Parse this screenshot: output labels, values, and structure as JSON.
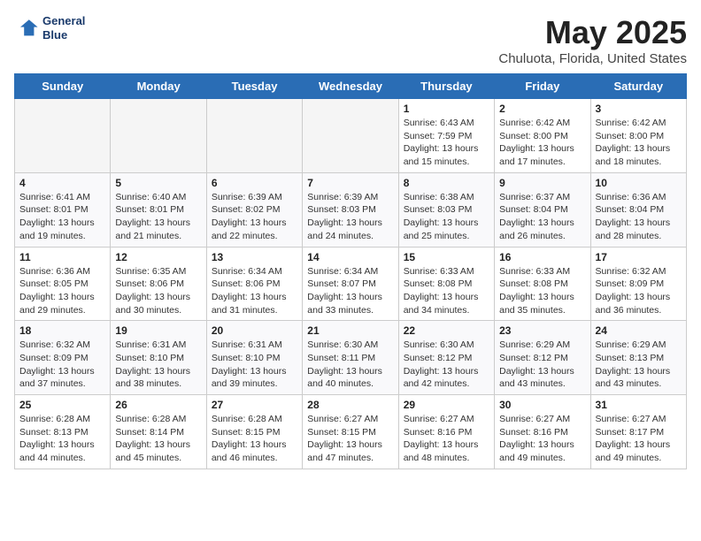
{
  "header": {
    "logo_line1": "General",
    "logo_line2": "Blue",
    "title": "May 2025",
    "subtitle": "Chuluota, Florida, United States"
  },
  "weekdays": [
    "Sunday",
    "Monday",
    "Tuesday",
    "Wednesday",
    "Thursday",
    "Friday",
    "Saturday"
  ],
  "weeks": [
    [
      {
        "day": "",
        "info": ""
      },
      {
        "day": "",
        "info": ""
      },
      {
        "day": "",
        "info": ""
      },
      {
        "day": "",
        "info": ""
      },
      {
        "day": "1",
        "info": "Sunrise: 6:43 AM\nSunset: 7:59 PM\nDaylight: 13 hours and 15 minutes."
      },
      {
        "day": "2",
        "info": "Sunrise: 6:42 AM\nSunset: 8:00 PM\nDaylight: 13 hours and 17 minutes."
      },
      {
        "day": "3",
        "info": "Sunrise: 6:42 AM\nSunset: 8:00 PM\nDaylight: 13 hours and 18 minutes."
      }
    ],
    [
      {
        "day": "4",
        "info": "Sunrise: 6:41 AM\nSunset: 8:01 PM\nDaylight: 13 hours and 19 minutes."
      },
      {
        "day": "5",
        "info": "Sunrise: 6:40 AM\nSunset: 8:01 PM\nDaylight: 13 hours and 21 minutes."
      },
      {
        "day": "6",
        "info": "Sunrise: 6:39 AM\nSunset: 8:02 PM\nDaylight: 13 hours and 22 minutes."
      },
      {
        "day": "7",
        "info": "Sunrise: 6:39 AM\nSunset: 8:03 PM\nDaylight: 13 hours and 24 minutes."
      },
      {
        "day": "8",
        "info": "Sunrise: 6:38 AM\nSunset: 8:03 PM\nDaylight: 13 hours and 25 minutes."
      },
      {
        "day": "9",
        "info": "Sunrise: 6:37 AM\nSunset: 8:04 PM\nDaylight: 13 hours and 26 minutes."
      },
      {
        "day": "10",
        "info": "Sunrise: 6:36 AM\nSunset: 8:04 PM\nDaylight: 13 hours and 28 minutes."
      }
    ],
    [
      {
        "day": "11",
        "info": "Sunrise: 6:36 AM\nSunset: 8:05 PM\nDaylight: 13 hours and 29 minutes."
      },
      {
        "day": "12",
        "info": "Sunrise: 6:35 AM\nSunset: 8:06 PM\nDaylight: 13 hours and 30 minutes."
      },
      {
        "day": "13",
        "info": "Sunrise: 6:34 AM\nSunset: 8:06 PM\nDaylight: 13 hours and 31 minutes."
      },
      {
        "day": "14",
        "info": "Sunrise: 6:34 AM\nSunset: 8:07 PM\nDaylight: 13 hours and 33 minutes."
      },
      {
        "day": "15",
        "info": "Sunrise: 6:33 AM\nSunset: 8:08 PM\nDaylight: 13 hours and 34 minutes."
      },
      {
        "day": "16",
        "info": "Sunrise: 6:33 AM\nSunset: 8:08 PM\nDaylight: 13 hours and 35 minutes."
      },
      {
        "day": "17",
        "info": "Sunrise: 6:32 AM\nSunset: 8:09 PM\nDaylight: 13 hours and 36 minutes."
      }
    ],
    [
      {
        "day": "18",
        "info": "Sunrise: 6:32 AM\nSunset: 8:09 PM\nDaylight: 13 hours and 37 minutes."
      },
      {
        "day": "19",
        "info": "Sunrise: 6:31 AM\nSunset: 8:10 PM\nDaylight: 13 hours and 38 minutes."
      },
      {
        "day": "20",
        "info": "Sunrise: 6:31 AM\nSunset: 8:10 PM\nDaylight: 13 hours and 39 minutes."
      },
      {
        "day": "21",
        "info": "Sunrise: 6:30 AM\nSunset: 8:11 PM\nDaylight: 13 hours and 40 minutes."
      },
      {
        "day": "22",
        "info": "Sunrise: 6:30 AM\nSunset: 8:12 PM\nDaylight: 13 hours and 42 minutes."
      },
      {
        "day": "23",
        "info": "Sunrise: 6:29 AM\nSunset: 8:12 PM\nDaylight: 13 hours and 43 minutes."
      },
      {
        "day": "24",
        "info": "Sunrise: 6:29 AM\nSunset: 8:13 PM\nDaylight: 13 hours and 43 minutes."
      }
    ],
    [
      {
        "day": "25",
        "info": "Sunrise: 6:28 AM\nSunset: 8:13 PM\nDaylight: 13 hours and 44 minutes."
      },
      {
        "day": "26",
        "info": "Sunrise: 6:28 AM\nSunset: 8:14 PM\nDaylight: 13 hours and 45 minutes."
      },
      {
        "day": "27",
        "info": "Sunrise: 6:28 AM\nSunset: 8:15 PM\nDaylight: 13 hours and 46 minutes."
      },
      {
        "day": "28",
        "info": "Sunrise: 6:27 AM\nSunset: 8:15 PM\nDaylight: 13 hours and 47 minutes."
      },
      {
        "day": "29",
        "info": "Sunrise: 6:27 AM\nSunset: 8:16 PM\nDaylight: 13 hours and 48 minutes."
      },
      {
        "day": "30",
        "info": "Sunrise: 6:27 AM\nSunset: 8:16 PM\nDaylight: 13 hours and 49 minutes."
      },
      {
        "day": "31",
        "info": "Sunrise: 6:27 AM\nSunset: 8:17 PM\nDaylight: 13 hours and 49 minutes."
      }
    ]
  ]
}
